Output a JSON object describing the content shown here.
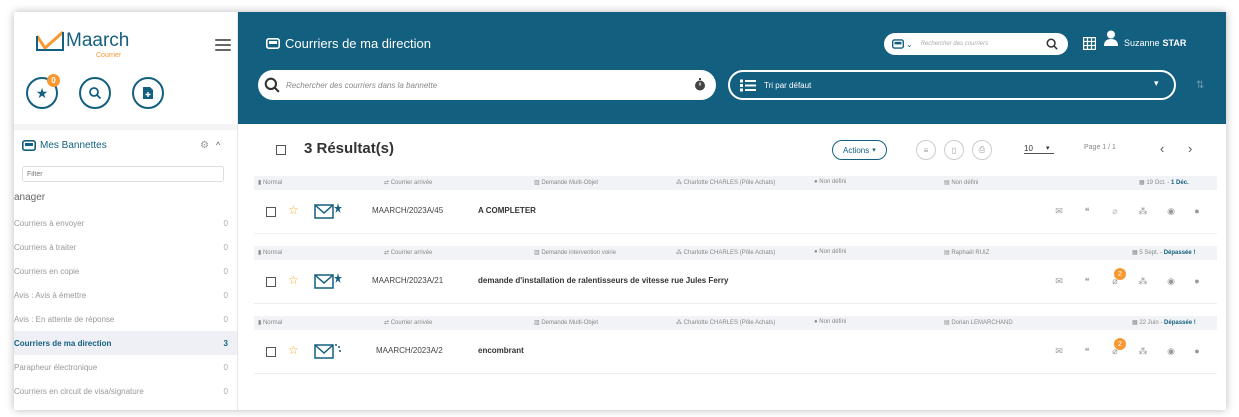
{
  "app": {
    "logo_text": "Maarch",
    "logo_sub": "Courrier",
    "accent": "#135f7f",
    "orange": "#f99830"
  },
  "sidebar": {
    "favorites_count": "0",
    "bannettes_title": "Mes Bannettes",
    "filter_placeholder": "Filter",
    "group_label": "anager",
    "items": [
      {
        "label": "Courriers à envoyer",
        "count": "0"
      },
      {
        "label": "Courriers à traiter",
        "count": "0"
      },
      {
        "label": "Courriers en copie",
        "count": "0"
      },
      {
        "label": "Avis : Avis à émettre",
        "count": "0"
      },
      {
        "label": "Avis : En attente de réponse",
        "count": "0"
      },
      {
        "label": "Courriers de ma direction",
        "count": "3"
      },
      {
        "label": "Parapheur électronique",
        "count": "0"
      },
      {
        "label": "Courriers en circuit de visa/signature",
        "count": "0"
      }
    ]
  },
  "header": {
    "title": "Courriers de ma direction",
    "top_search_placeholder": "Rechercher des courriers",
    "user_first": "Suzanne",
    "user_last": "STAR",
    "search_placeholder": "Rechercher des courriers dans la bannette",
    "sort_label": "Tri par défaut"
  },
  "results": {
    "title": "3 Résultat(s)",
    "actions_label": "Actions",
    "per_page": "10",
    "page_info": "Page 1 / 1",
    "rows": [
      {
        "priority": "Normal",
        "category": "Courrier arrivée",
        "doctype": "Demande Multi-Objet",
        "entity": "Charlotte CHARLES (Pôle Achats)",
        "contact": "Non défini",
        "recipient": "Non défini",
        "date": "19 Oct. -",
        "deadline": "1 Déc.",
        "chrono": "MAARCH/2023A/45",
        "subject": "A COMPLETER",
        "attachments": ""
      },
      {
        "priority": "Normal",
        "category": "Courrier arrivée",
        "doctype": "Demande intervention voirie",
        "entity": "Charlotte CHARLES (Pôle Achats)",
        "contact": "Non défini",
        "recipient": "Raphaël RUIZ",
        "date": "5 Sept. -",
        "deadline": "Dépassée !",
        "chrono": "MAARCH/2023A/21",
        "subject": "demande d'installation de ralentisseurs de vitesse rue Jules Ferry",
        "attachments": "2"
      },
      {
        "priority": "Normal",
        "category": "Courrier arrivée",
        "doctype": "Demande Multi-Objet",
        "entity": "Charlotte CHARLES (Pôle Achats)",
        "contact": "Non défini",
        "recipient": "Dorian LEMARCHAND",
        "date": "22 Juin -",
        "deadline": "Dépassée !",
        "chrono": "MAARCH/2023A/2",
        "subject": "encombrant",
        "attachments": "2"
      }
    ]
  }
}
